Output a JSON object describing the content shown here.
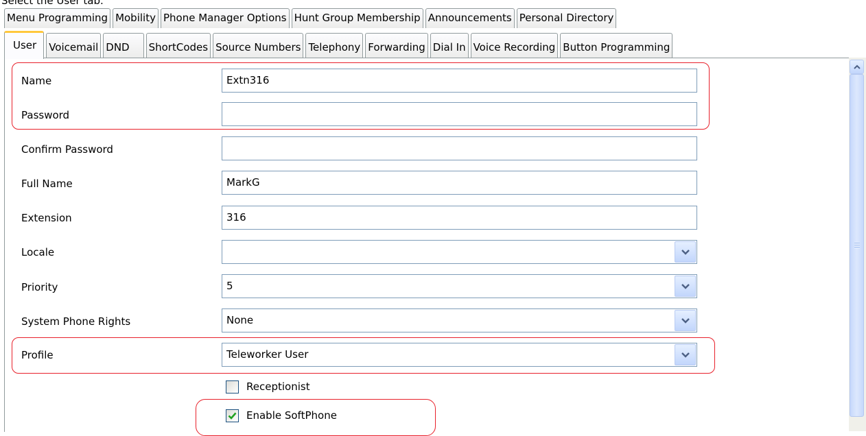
{
  "caption": "Select the User tab.",
  "tabs_row1": [
    "Menu Programming",
    "Mobility",
    "Phone Manager Options",
    "Hunt Group Membership",
    "Announcements",
    "Personal Directory"
  ],
  "tabs_row2": [
    "User",
    "Voicemail",
    "DND",
    "ShortCodes",
    "Source Numbers",
    "Telephony",
    "Forwarding",
    "Dial In",
    "Voice Recording",
    "Button Programming"
  ],
  "active_tab": "User",
  "form": {
    "name": {
      "label": "Name",
      "value": "Extn316"
    },
    "password": {
      "label": "Password",
      "value": ""
    },
    "confirm_password": {
      "label": "Confirm Password",
      "value": ""
    },
    "full_name": {
      "label": "Full Name",
      "value": "MarkG"
    },
    "extension": {
      "label": "Extension",
      "value": "316"
    },
    "locale": {
      "label": "Locale",
      "value": ""
    },
    "priority": {
      "label": "Priority",
      "value": "5"
    },
    "system_phone_rights": {
      "label": "System Phone Rights",
      "value": "None"
    },
    "profile": {
      "label": "Profile",
      "value": "Teleworker User"
    },
    "receptionist": {
      "label": "Receptionist",
      "checked": false
    },
    "enable_softphone": {
      "label": "Enable SoftPhone",
      "checked": true
    }
  },
  "colors": {
    "highlight": "#e8202a",
    "tab_accent": "#ffc83c",
    "input_border": "#7f9db9",
    "check": "#21a121"
  },
  "icons": {
    "combo": "chevron-down-icon",
    "scroll_up": "arrow-up-icon",
    "check": "checkmark-icon"
  }
}
